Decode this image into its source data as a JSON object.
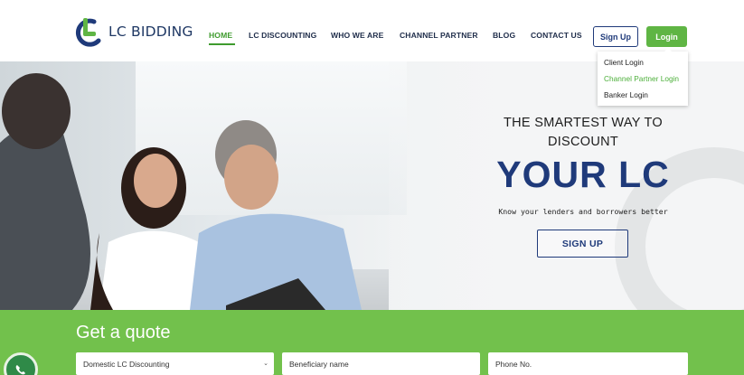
{
  "brand": {
    "name": "LC BIDDING",
    "green": "#5fb544",
    "navy": "#1f3a7a"
  },
  "nav": {
    "items": [
      "HOME",
      "LC DISCOUNTING",
      "WHO WE ARE",
      "CHANNEL PARTNER",
      "BLOG",
      "CONTACT US"
    ],
    "active": "HOME"
  },
  "auth": {
    "signup_label": "Sign Up",
    "login_label": "Login"
  },
  "login_menu": {
    "items": [
      "Client Login",
      "Channel Partner Login",
      "Banker Login"
    ],
    "highlighted": "Channel Partner Login"
  },
  "hero": {
    "line1": "THE SMARTEST WAY TO",
    "line2": "DISCOUNT",
    "big": "YOUR LC",
    "tagline": "Know your lenders and borrowers better",
    "cta_label": "SIGN UP"
  },
  "quote": {
    "title": "Get a quote",
    "fields": [
      {
        "value": "Domestic LC Discounting",
        "type": "select"
      },
      {
        "placeholder": "Beneficiary name",
        "type": "text"
      },
      {
        "placeholder": "Phone No.",
        "type": "text"
      }
    ]
  },
  "icons": {
    "whatsapp": "whatsapp-icon",
    "dropdown": "chevron-down-icon"
  }
}
